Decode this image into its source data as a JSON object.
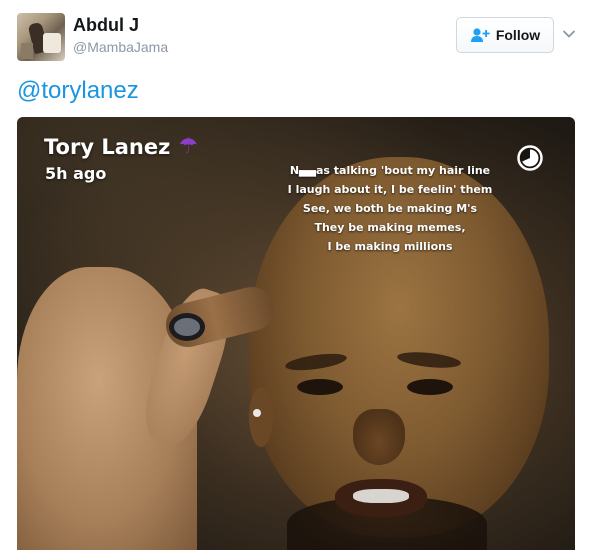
{
  "tweet": {
    "user": {
      "name": "Abdul J",
      "handle": "@MambaJama"
    },
    "follow_button": {
      "label": "Follow",
      "icon": "add-user-icon",
      "accent_color": "#1da1f2"
    },
    "menu_icon": "chevron-down-icon",
    "text": "@torylanez",
    "link_color": "#1b95e0"
  },
  "media": {
    "snap_user": "Tory Lanez",
    "snap_user_icon": "umbrella-icon",
    "snap_user_icon_color": "#8b3fc9",
    "snap_time": "5h ago",
    "timer_icon": "snap-timer-icon",
    "lyrics": [
      "N▄▄as talking 'bout my hair line",
      "I laugh about it, I be feelin' them",
      "See, we both be making M's",
      "They be making memes,",
      "I be making millions"
    ]
  }
}
